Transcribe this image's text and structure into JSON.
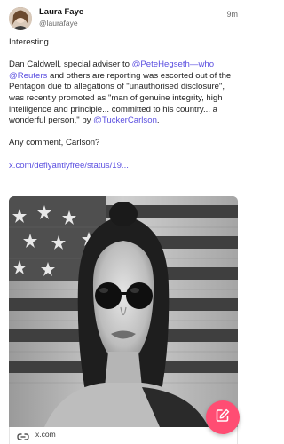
{
  "post": {
    "author_name": "Laura Faye",
    "author_handle": "@laurafaye",
    "time": "9m",
    "intro": "Interesting.",
    "body_part1": "Dan Caldwell, special adviser to ",
    "mention1": "@PeteHegseth—who",
    "mention2": "@Reuters",
    "body_part2": " and others are reporting was escorted out of the Pentagon due to allegations of \"unauthorised disclosure\", was recently promoted as \"man of genuine integrity, high intelligence and principle... committed to his country... a wonderful person,\" by ",
    "mention3": "@TuckerCarlson",
    "body_part3": ".",
    "question": "Any comment, Carlson?",
    "link": "x.com/defiyantlyfree/status/19..."
  },
  "link_card": {
    "domain": "x.com"
  },
  "icons": {
    "link": "link-icon",
    "compose": "compose-icon"
  },
  "colors": {
    "accent": "#5b4fe0",
    "fab": "#ff4d73"
  }
}
